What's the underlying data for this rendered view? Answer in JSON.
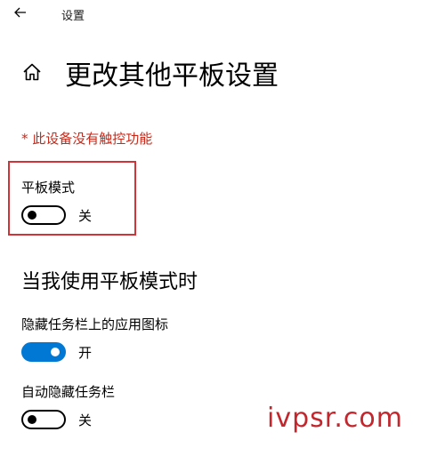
{
  "window": {
    "app_title": "设置"
  },
  "page": {
    "title": "更改其他平板设置"
  },
  "warning": "* 此设备没有触控功能",
  "tablet_mode": {
    "label": "平板模式",
    "state": "关",
    "on": false
  },
  "section": {
    "heading": "当我使用平板模式时",
    "settings": [
      {
        "label": "隐藏任务栏上的应用图标",
        "state": "开",
        "on": true
      },
      {
        "label": "自动隐藏任务栏",
        "state": "关",
        "on": false
      }
    ]
  },
  "watermark": "ivpsr.com",
  "colors": {
    "accent": "#0078d4",
    "warning": "#c42b1c",
    "highlight": "#d13438",
    "watermark": "#c1272d"
  },
  "icons": {
    "back": "back-arrow-icon",
    "home": "home-icon"
  }
}
